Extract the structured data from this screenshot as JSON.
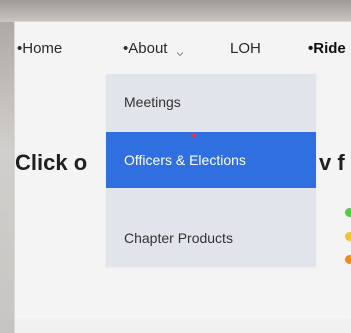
{
  "nav": {
    "items": [
      {
        "label": "•Home"
      },
      {
        "label": "•About"
      },
      {
        "label": "LOH"
      },
      {
        "label": "•Ride"
      }
    ]
  },
  "dropdown": {
    "items": [
      {
        "label": "Meetings"
      },
      {
        "label": "Officers & Elections"
      },
      {
        "label": "Chapter Products"
      }
    ]
  },
  "content": {
    "headline_left": "Click o",
    "headline_right": "v f"
  },
  "colors": {
    "active_menu": "#2f6fe0",
    "status_green": "#57c84a",
    "status_yellow": "#f1c232",
    "status_orange": "#f08a1a",
    "cursor": "#ff2d2d"
  }
}
